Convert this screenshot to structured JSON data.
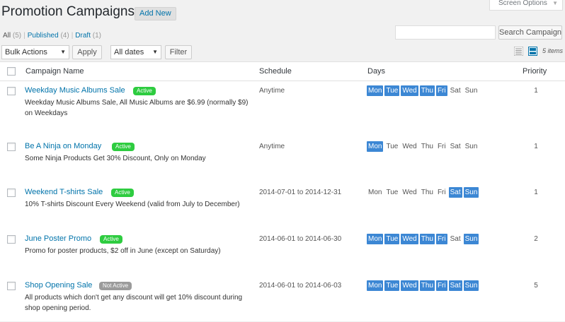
{
  "page": {
    "title": "Promotion Campaigns",
    "add_new": "Add New"
  },
  "screen_options": {
    "label": "Screen Options"
  },
  "views": [
    {
      "label": "All",
      "count": "(5)"
    },
    {
      "label": "Published",
      "count": "(4)"
    },
    {
      "label": "Draft",
      "count": "(1)"
    }
  ],
  "search": {
    "placeholder": "",
    "button": "Search Campaign"
  },
  "bulk": {
    "select": "Bulk Actions",
    "apply": "Apply"
  },
  "dates_filter": {
    "select": "All dates",
    "button": "Filter"
  },
  "items_count": "5 items",
  "columns": {
    "name": "Campaign Name",
    "schedule": "Schedule",
    "days": "Days",
    "priority": "Priority"
  },
  "day_labels": [
    "Mon",
    "Tue",
    "Wed",
    "Thu",
    "Fri",
    "Sat",
    "Sun"
  ],
  "colors": {
    "active_badge": "#2ecc40",
    "inactive_badge": "#9b9b9b",
    "day_selected": "#3c87d4",
    "link": "#0073aa"
  },
  "rows": [
    {
      "name": "Weekday Music Albums Sale",
      "status": "Active",
      "description": "Weekday Music Albums Sale, All Music Albums are $6.99 (normally $9) on Weekdays",
      "schedule": "Anytime",
      "days": [
        true,
        true,
        true,
        true,
        true,
        false,
        false
      ],
      "priority": "1"
    },
    {
      "name": "Be A Ninja on Monday",
      "status": "Active",
      "description": "Some Ninja Products Get 30% Discount, Only on Monday",
      "schedule": "Anytime",
      "days": [
        true,
        false,
        false,
        false,
        false,
        false,
        false
      ],
      "priority": "1"
    },
    {
      "name": "Weekend T-shirts Sale",
      "status": "Active",
      "description": "10% T-shirts Discount Every Weekend (valid from July to December)",
      "schedule": "2014-07-01 to 2014-12-31",
      "days": [
        false,
        false,
        false,
        false,
        false,
        true,
        true
      ],
      "priority": "1"
    },
    {
      "name": "June Poster Promo",
      "status": "Active",
      "description": "Promo for poster products, $2 off in June (except on Saturday)",
      "schedule": "2014-06-01 to 2014-06-30",
      "days": [
        true,
        true,
        true,
        true,
        true,
        false,
        true
      ],
      "priority": "2"
    },
    {
      "name": "Shop Opening Sale",
      "status": "Not Active",
      "description": "All products which don't get any discount will get 10% discount during shop opening period.",
      "schedule": "2014-06-01 to 2014-06-03",
      "days": [
        true,
        true,
        true,
        true,
        true,
        true,
        true
      ],
      "priority": "5"
    }
  ]
}
